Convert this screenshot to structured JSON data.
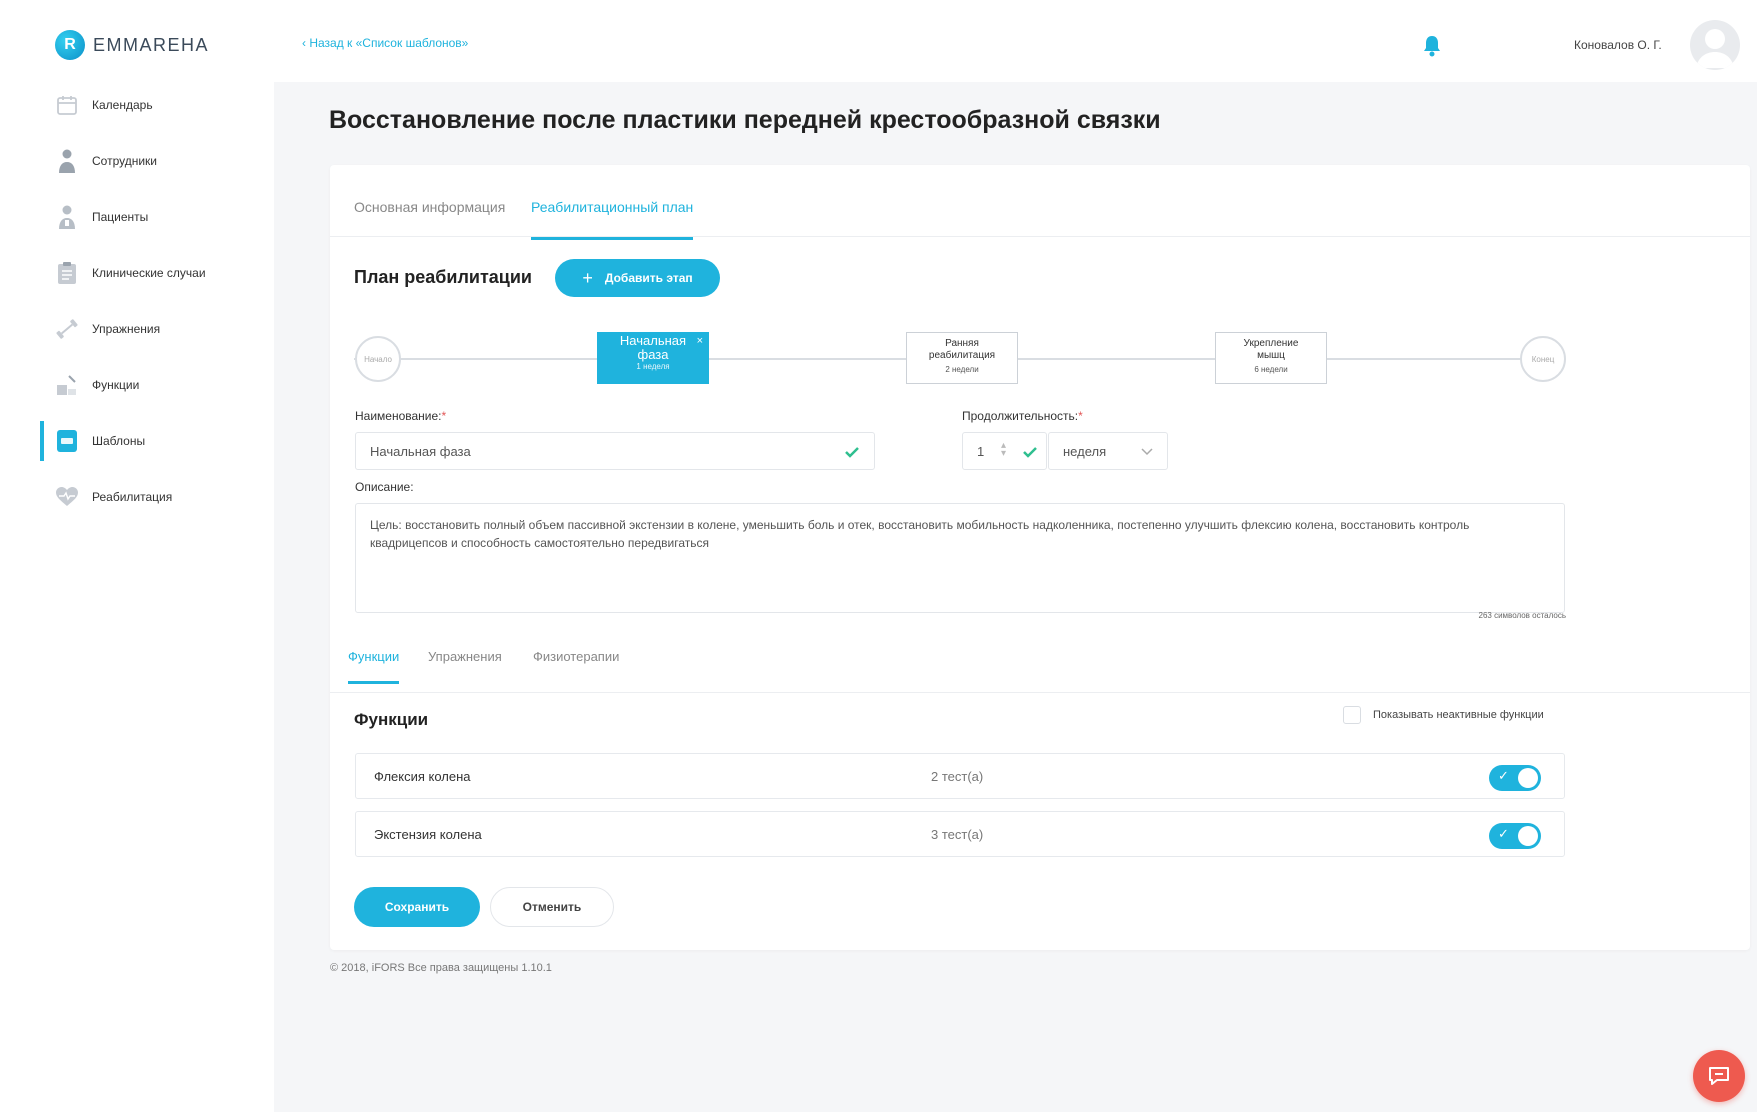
{
  "app": {
    "logo_text": "EMMAREHA",
    "logo_letter": "R",
    "back_link": "‹  Назад к «Список шаблонов»",
    "user_name": "Коновалов О. Г.",
    "accent_color": "#1fb3dd",
    "chat_color": "#ee5a4f"
  },
  "sidebar": {
    "items": [
      {
        "label": "Календарь",
        "icon": "calendar-icon"
      },
      {
        "label": "Сотрудники",
        "icon": "staff-icon"
      },
      {
        "label": "Пациенты",
        "icon": "patients-icon"
      },
      {
        "label": "Клинические случаи",
        "icon": "clipboard-icon"
      },
      {
        "label": "Упражнения",
        "icon": "dumbbell-icon"
      },
      {
        "label": "Функции",
        "icon": "functions-icon"
      },
      {
        "label": "Шаблоны",
        "icon": "templates-icon",
        "active": true
      },
      {
        "label": "Реабилитация",
        "icon": "heart-icon"
      }
    ]
  },
  "page": {
    "title": "Восстановление после пластики передней крестообразной связки",
    "tabs": [
      "Основная информация",
      "Реабилитационный план"
    ],
    "active_tab": "Реабилитационный план"
  },
  "plan": {
    "title": "План реабилитации",
    "add_stage_label": "Добавить этап",
    "start_label": "Начало",
    "end_label": "Конец",
    "stages": [
      {
        "name": "Начальная фаза",
        "duration": "1 неделя",
        "active": true
      },
      {
        "name": "Ранняя реабилитация",
        "duration": "2 недели"
      },
      {
        "name": "Укрепление мышц",
        "duration": "6 недели"
      }
    ]
  },
  "form": {
    "name_label": "Наименование:",
    "name_value": "Начальная фаза",
    "duration_label": "Продолжительность:",
    "duration_value": "1",
    "duration_unit": "неделя",
    "description_label": "Описание:",
    "description_value": "Цель: восстановить полный объем пассивной экстензии в колене, уменьшить боль и отек, восстановить мобильность надколенника, постепенно улучшить флексию колена, восстановить контроль квадрицепсов и способность самостоятельно передвигаться",
    "chars_left": "263 символов осталось"
  },
  "subtabs": {
    "items": [
      "Функции",
      "Упражнения",
      "Физиотерапии"
    ],
    "active": "Функции"
  },
  "functions": {
    "title": "Функции",
    "show_inactive_label": "Показывать неактивные функции",
    "rows": [
      {
        "name": "Флексия колена",
        "tests": "2 тест(а)",
        "enabled": true
      },
      {
        "name": "Экстензия колена",
        "tests": "3 тест(а)",
        "enabled": true
      }
    ]
  },
  "actions": {
    "save_label": "Сохранить",
    "cancel_label": "Отменить"
  },
  "footer": {
    "text": "© 2018, iFORS  Все права защищены 1.10.1"
  }
}
